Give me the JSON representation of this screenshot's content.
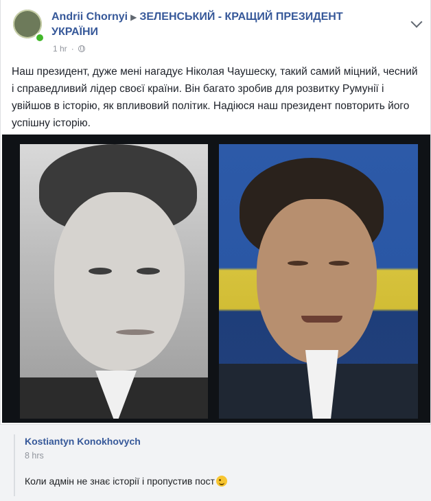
{
  "post": {
    "author": "Andrii Chornyi",
    "group": "ЗЕЛЕНСЬКИЙ - КРАЩИЙ ПРЕЗИДЕНТ УКРАЇНИ",
    "time": "1 hr",
    "privacy_icon": "globe-icon",
    "text": "Наш президент, дуже мені нагадує Ніколая Чаушеску, такий самий міцний, чесний і справедливий лідер своєї країни. Він багато зробив для розвитку Румунії і увійшов в історію, як впливовий політик. Надіюся наш президент повторить його успішну історію."
  },
  "comment": {
    "author": "Kostiantyn Konokhovych",
    "time": "8 hrs",
    "text": "Коли адмін не знає історії і пропустив пост",
    "emoji": "emoji-wink-icon"
  },
  "colors": {
    "link": "#365899",
    "meta": "#90949c",
    "online": "#42b72a",
    "comment_bg": "#f2f3f5"
  }
}
